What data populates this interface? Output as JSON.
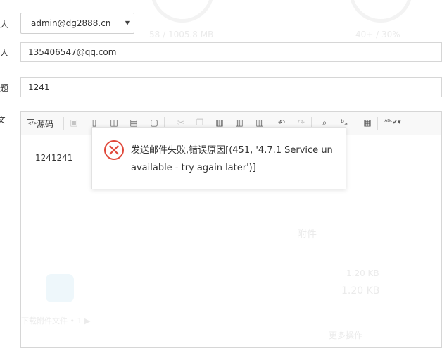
{
  "form": {
    "sender_label": "送人",
    "sender_value": "admin@dg2888.cn",
    "recipient_label": "牛人",
    "recipient_value": "135406547@qq.com",
    "subject_label": "主题",
    "subject_value": "1241",
    "body_label": "E文"
  },
  "editor": {
    "source_label": "源码",
    "content": "1241241"
  },
  "dialog": {
    "message": "发送邮件失败,错误原因[(451, '4.7.1 Service unavailable - try again later')]",
    "icon": "error-circle-icon",
    "icon_color": "#e0483a"
  },
  "background": {
    "ring_left_text": "58 / 1005.8 MB",
    "ring_right_text": "40+ / 30%",
    "faded_label": "附件",
    "faded_size_1": "1.20 KB",
    "faded_size_2": "1.20 KB",
    "faded_link": "下载附件文件 • 1 ▶",
    "faded_bottom": "更多操作"
  }
}
